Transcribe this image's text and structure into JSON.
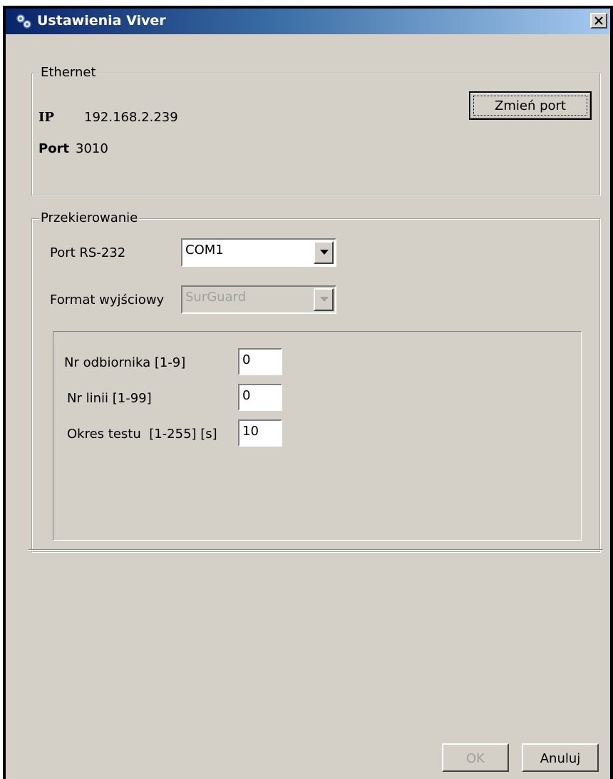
{
  "window": {
    "title": "Ustawienia Viver",
    "close_label": "x",
    "icon": "viver-app-icon"
  },
  "ethernet": {
    "legend": "Ethernet",
    "ip_label": "IP",
    "ip_value": "192.168.2.239",
    "port_label": "Port",
    "port_value": "3010",
    "change_port_button": "Zmień port"
  },
  "redirect": {
    "legend": "Przekierowanie",
    "rs232_label": "Port RS-232",
    "rs232_value": "COM1",
    "format_label": "Format wyjściowy",
    "format_value": "SurGuard",
    "receiver_label": "Nr odbiornika [1-9]",
    "receiver_value": "0",
    "line_label": "Nr linii [1-99]",
    "line_value": "0",
    "test_period_label": "Okres testu  [1-255] [s]",
    "test_period_value": "10"
  },
  "footer": {
    "ok_label": "OK",
    "cancel_label": "Anuluj"
  }
}
